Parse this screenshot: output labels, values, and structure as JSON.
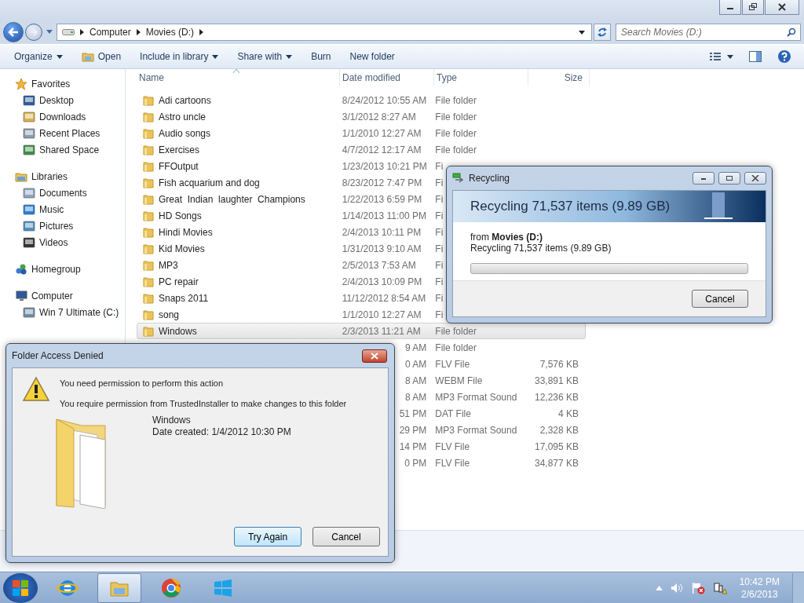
{
  "address_bar": {
    "segments": [
      "Computer",
      "Movies (D:)"
    ]
  },
  "search": {
    "placeholder": "Search Movies (D:)"
  },
  "toolbar": {
    "items": [
      {
        "label": "Organize",
        "kind": "menu"
      },
      {
        "label": "Open",
        "kind": "icon"
      },
      {
        "label": "Include in library",
        "kind": "menu"
      },
      {
        "label": "Share with",
        "kind": "menu"
      },
      {
        "label": "Burn",
        "kind": "plain"
      },
      {
        "label": "New folder",
        "kind": "plain"
      }
    ]
  },
  "sidebar": {
    "groups": [
      {
        "label": "Favorites",
        "children": [
          {
            "label": "Desktop"
          },
          {
            "label": "Downloads"
          },
          {
            "label": "Recent Places"
          },
          {
            "label": "Shared Space"
          }
        ]
      },
      {
        "label": "Libraries",
        "children": [
          {
            "label": "Documents"
          },
          {
            "label": "Music"
          },
          {
            "label": "Pictures"
          },
          {
            "label": "Videos"
          }
        ]
      },
      {
        "label": "Homegroup"
      },
      {
        "label": "Computer",
        "children": [
          {
            "label": "Win 7 Ultimate (C:)"
          }
        ]
      }
    ]
  },
  "file_list": {
    "columns": [
      "Name",
      "Date modified",
      "Type",
      "Size"
    ],
    "rows": [
      {
        "name": "Adi cartoons",
        "date": "8/24/2012 10:55 AM",
        "type": "File folder",
        "selected": false
      },
      {
        "name": "Astro uncle",
        "date": "3/1/2012 8:27 AM",
        "type": "File folder",
        "selected": false
      },
      {
        "name": "Audio songs",
        "date": "1/1/2010 12:27 AM",
        "type": "File folder",
        "selected": false
      },
      {
        "name": "Exercises",
        "date": "4/7/2012 12:17 AM",
        "type": "File folder",
        "selected": false
      },
      {
        "name": "FFOutput",
        "date": "1/23/2013 10:21 PM",
        "type": "Fi",
        "selected": false
      },
      {
        "name": "Fish acquarium and dog",
        "date": "8/23/2012 7:47 PM",
        "type": "Fi",
        "selected": false
      },
      {
        "name": "Great  Indian  laughter  Champions",
        "date": "1/22/2013 6:59 PM",
        "type": "Fi",
        "selected": false
      },
      {
        "name": "HD Songs",
        "date": "1/14/2013 11:00 PM",
        "type": "Fi",
        "selected": false
      },
      {
        "name": "Hindi Movies",
        "date": "2/4/2013 10:11 PM",
        "type": "Fi",
        "selected": false
      },
      {
        "name": "Kid Movies",
        "date": "1/31/2013 9:10 AM",
        "type": "Fi",
        "selected": false
      },
      {
        "name": "MP3",
        "date": "2/5/2013 7:53 AM",
        "type": "Fi",
        "selected": false
      },
      {
        "name": "PC repair",
        "date": "2/4/2013 10:09 PM",
        "type": "Fi",
        "selected": false
      },
      {
        "name": "Snaps 2011",
        "date": "11/12/2012 8:54 AM",
        "type": "Fi",
        "selected": false
      },
      {
        "name": "song",
        "date": "1/1/2010 12:27 AM",
        "type": "Fi",
        "selected": false
      },
      {
        "name": "Windows",
        "date": "2/3/2013 11:21 AM",
        "type": "File folder",
        "selected": true
      },
      {
        "date": "9 AM",
        "type": "File folder",
        "selected": false
      },
      {
        "date": "0 AM",
        "type": "FLV File",
        "size": "7,576 KB",
        "selected": false
      },
      {
        "date": "8 AM",
        "type": "WEBM File",
        "size": "33,891 KB",
        "selected": false
      },
      {
        "date": "8 AM",
        "type": "MP3 Format Sound",
        "size": "12,236 KB",
        "selected": false
      },
      {
        "date": "51 PM",
        "type": "DAT File",
        "size": "4 KB",
        "selected": false
      },
      {
        "date": "29 PM",
        "type": "MP3 Format Sound",
        "size": "2,328 KB",
        "selected": false
      },
      {
        "date": "14 PM",
        "type": "FLV File",
        "size": "17,095 KB",
        "selected": false
      },
      {
        "date": "0 PM",
        "type": "FLV File",
        "size": "34,877 KB",
        "selected": false
      }
    ]
  },
  "recycling_dialog": {
    "title": "Recycling",
    "heading": "Recycling 71,537 items (9.89 GB)",
    "source": "from **Movies (D:)**",
    "status": "Recycling 71,537 items (9.89 GB)",
    "progress": {
      "level": 0
    },
    "buttons": [
      "Cancel"
    ]
  },
  "access_denied_dialog": {
    "title": "Folder Access Denied",
    "message": "You need permission to perform this action",
    "detail": "You require permission from TrustedInstaller to make changes to this folder",
    "item_name": "Windows",
    "item_date": "Date created: 1/4/2012 10:30 PM",
    "buttons": [
      {
        "label": "Try Again",
        "default": true
      },
      {
        "label": "Cancel",
        "default": false
      }
    ]
  },
  "taskbar": {
    "apps": [
      {
        "selected": false
      },
      {
        "selected": true
      },
      {
        "selected": false
      },
      {
        "selected": false
      }
    ],
    "clock": {
      "time": "10:42 PM",
      "date": "2/6/2013"
    }
  }
}
